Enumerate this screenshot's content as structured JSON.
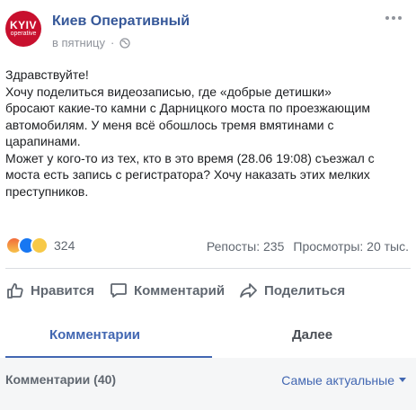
{
  "header": {
    "avatar_logo": "KYIV",
    "avatar_sub": "operative",
    "page_name": "Киев Оперативный",
    "time": "в пятницу"
  },
  "post": {
    "text": "Здравствуйте!\nХочу поделиться видеозаписью, где «добрые детишки»\nбросают какие-то камни с Дарницкого моста по проезжающим\nавтомобилям. У меня всё обошлось тремя вмятинами с\nцарапинами.\nМожет у кого-то из тех, кто в это время (28.06 19:08) съезжал с\nмоста есть запись с регистратора? Хочу наказать этих мелких\nпреступников."
  },
  "reactions": {
    "count": "324",
    "reposts": "Репосты: 235",
    "views": "Просмотры: 20 тыс."
  },
  "actions": {
    "like": "Нравится",
    "comment": "Комментарий",
    "share": "Поделиться"
  },
  "tabs": {
    "comments": "Комментарии",
    "next": "Далее"
  },
  "comments": {
    "title": "Комментарии (40)",
    "sort": "Самые актуальные"
  }
}
